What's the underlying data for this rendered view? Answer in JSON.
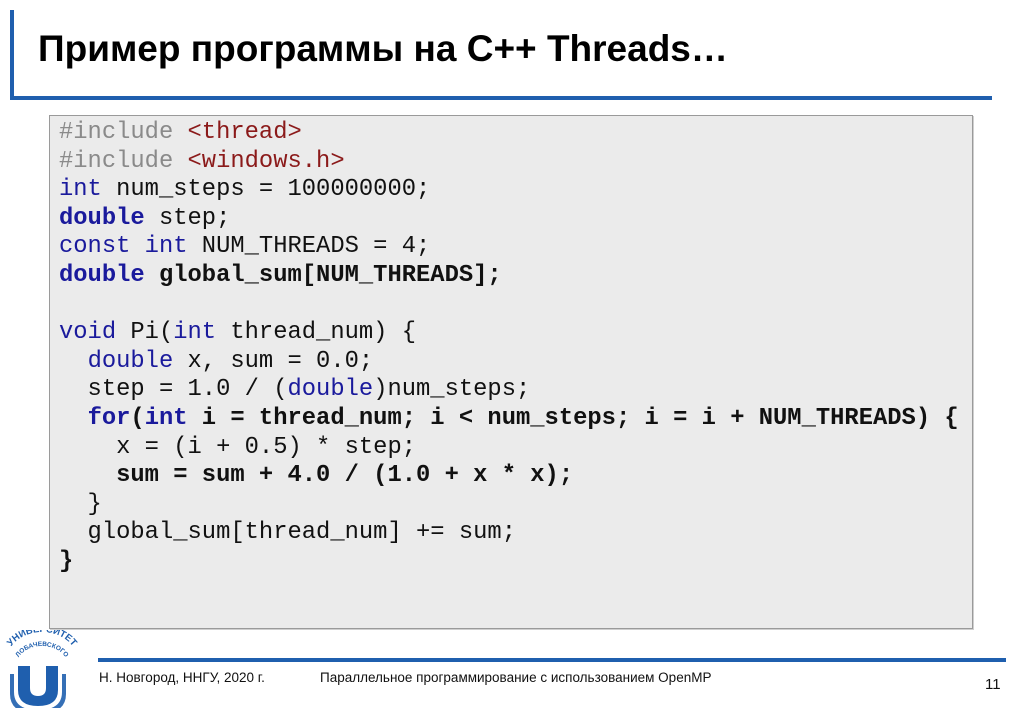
{
  "slide": {
    "title": "Пример программы на C++ Threads…",
    "accent_color": "#1f5fae"
  },
  "code": {
    "lines": [
      [
        {
          "t": "#include ",
          "c": "pp"
        },
        {
          "t": "<thread>",
          "c": "inc"
        }
      ],
      [
        {
          "t": "#include ",
          "c": "pp"
        },
        {
          "t": "<windows.h>",
          "c": "inc"
        }
      ],
      [
        {
          "t": "int",
          "c": "kw"
        },
        {
          "t": " num_steps = 100000000;",
          "c": ""
        }
      ],
      [
        {
          "t": "double",
          "c": "kw b"
        },
        {
          "t": " step;",
          "c": ""
        }
      ],
      [
        {
          "t": "const int",
          "c": "kw"
        },
        {
          "t": " NUM_THREADS = 4;",
          "c": ""
        }
      ],
      [
        {
          "t": "double",
          "c": "kw b"
        },
        {
          "t": " global_sum[NUM_THREADS];",
          "c": "b"
        }
      ],
      [
        {
          "t": "",
          "c": ""
        }
      ],
      [
        {
          "t": "void",
          "c": "kw"
        },
        {
          "t": " Pi(",
          "c": ""
        },
        {
          "t": "int",
          "c": "kw"
        },
        {
          "t": " thread_num) {",
          "c": ""
        }
      ],
      [
        {
          "t": "  ",
          "c": ""
        },
        {
          "t": "double",
          "c": "kw"
        },
        {
          "t": " x, sum = 0.0;",
          "c": ""
        }
      ],
      [
        {
          "t": "  step = 1.0 / (",
          "c": ""
        },
        {
          "t": "double",
          "c": "kw"
        },
        {
          "t": ")num_steps;",
          "c": ""
        }
      ],
      [
        {
          "t": "  ",
          "c": ""
        },
        {
          "t": "for",
          "c": "kw b"
        },
        {
          "t": "(",
          "c": "b"
        },
        {
          "t": "int",
          "c": "kw b"
        },
        {
          "t": " i = thread_num; i < num_steps; i = i + NUM_THREADS) {",
          "c": "b"
        }
      ],
      [
        {
          "t": "    x = (i + 0.5) * step;",
          "c": ""
        }
      ],
      [
        {
          "t": "    sum = sum + 4.0 / (1.0 + x * x);",
          "c": "b"
        }
      ],
      [
        {
          "t": "  }",
          "c": ""
        }
      ],
      [
        {
          "t": "  global_sum[thread_num] += sum;",
          "c": ""
        }
      ],
      [
        {
          "t": "}",
          "c": "b"
        }
      ]
    ]
  },
  "footer": {
    "left": "Н. Новгород,  ННГУ, 2020 г.",
    "center": "Параллельное программирование с использованием OpenMP",
    "page_number": "11",
    "logo_text_top": "УНИВЕРСИТЕТ",
    "logo_text_bottom": "ЛОБАЧЕВСКОГО"
  }
}
